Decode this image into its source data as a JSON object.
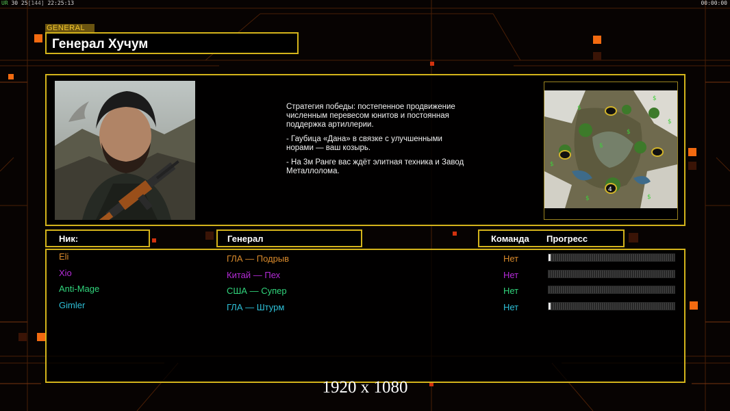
{
  "hud": {
    "left_ur": "UR",
    "left_nums": "30 25",
    "left_bracket": "[144]",
    "left_time": "22:25:13",
    "right_timer": "00:00:00"
  },
  "general": {
    "tag": "GENERAL",
    "name": "Генерал Хучум"
  },
  "strategy": {
    "p1": "Стратегия победы: постепенное продвижение численным перевесом юнитов и постоянная поддержка артиллерии.",
    "p2": "- Гаубица «Дана» в связке с улучшенными норами — ваш козырь.",
    "p3": "- На 3м Ранге вас ждёт элитная техника и Завод Металлолома."
  },
  "table": {
    "col_nick": "Ник:",
    "col_general": "Генерал",
    "col_team": "Команда",
    "col_progress": "Прогресс"
  },
  "players": [
    {
      "nick": "Eli",
      "general": "ГЛА — Подрыв",
      "team": "Нет",
      "progress": 0.01,
      "color": "#d98a2b"
    },
    {
      "nick": "Xio",
      "general": "Китай — Пех",
      "team": "Нет",
      "progress": 0.0,
      "color": "#b52bd8"
    },
    {
      "nick": "Anti-Mage",
      "general": "США — Супер",
      "team": "Нет",
      "progress": 0.0,
      "color": "#31d57c"
    },
    {
      "nick": "Gimler",
      "general": "ГЛА — Штурм",
      "team": "Нет",
      "progress": 0.01,
      "color": "#2ec0d8"
    }
  ],
  "map": {
    "start_marker": "4"
  },
  "resolution_text": "1920 x 1080",
  "colors": {
    "accent_border": "#d4b41b",
    "accent_orange": "#f26a10",
    "grid_line": "#5a2608"
  }
}
